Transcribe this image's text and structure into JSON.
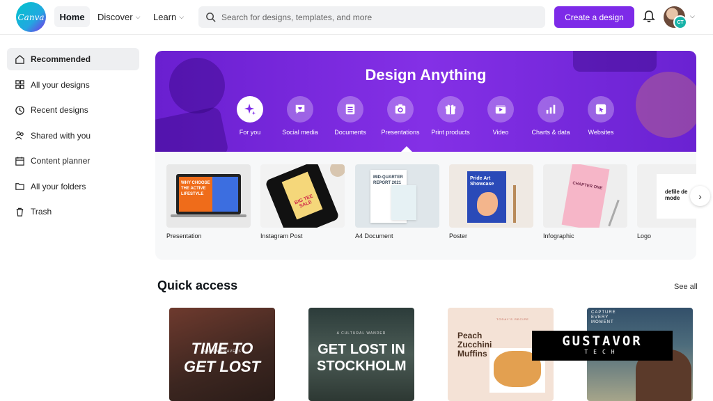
{
  "brand": {
    "logo_text": "Canva",
    "accent": "#7d2ae8"
  },
  "topnav": {
    "home": "Home",
    "discover": "Discover",
    "learn": "Learn",
    "search_placeholder": "Search for designs, templates, and more",
    "create_button": "Create a design",
    "avatar_initials": "CT"
  },
  "sidebar": {
    "items": [
      {
        "label": "Recommended",
        "icon": "home-icon"
      },
      {
        "label": "All your designs",
        "icon": "grid-icon"
      },
      {
        "label": "Recent designs",
        "icon": "clock-icon"
      },
      {
        "label": "Shared with you",
        "icon": "people-icon"
      },
      {
        "label": "Content planner",
        "icon": "calendar-icon"
      },
      {
        "label": "All your folders",
        "icon": "folder-icon"
      },
      {
        "label": "Trash",
        "icon": "trash-icon"
      }
    ]
  },
  "hero": {
    "title": "Design Anything",
    "categories": [
      {
        "label": "For you",
        "icon": "sparkle-icon"
      },
      {
        "label": "Social media",
        "icon": "heart-chat-icon"
      },
      {
        "label": "Documents",
        "icon": "document-icon"
      },
      {
        "label": "Presentations",
        "icon": "presentation-icon"
      },
      {
        "label": "Print products",
        "icon": "gift-icon"
      },
      {
        "label": "Video",
        "icon": "video-icon"
      },
      {
        "label": "Charts & data",
        "icon": "bar-chart-icon"
      },
      {
        "label": "Websites",
        "icon": "cursor-icon"
      }
    ]
  },
  "templates": [
    {
      "label": "Presentation",
      "thumb_text": "WHY CHOOSE THE ACTIVE LIFESTYLE"
    },
    {
      "label": "Instagram Post",
      "thumb_text": "BIG TEE SALE"
    },
    {
      "label": "A4 Document",
      "thumb_text": "MID-QUARTER REPORT 2021"
    },
    {
      "label": "Poster",
      "thumb_text": "Pride Art Showcase"
    },
    {
      "label": "Infographic",
      "thumb_text": "CHAPTER ONE"
    },
    {
      "label": "Logo",
      "thumb_text": "defile de mode"
    }
  ],
  "quick_access": {
    "title": "Quick access",
    "see_all": "See all",
    "cards": [
      {
        "small": "SILTON TRAVELS",
        "big": "TIME TO GET LOST"
      },
      {
        "small": "A CULTURAL WANDER",
        "big": "GET LOST IN STOCKHOLM"
      },
      {
        "small": "TODAY'S RECIPE",
        "big": "Peach Zucchini Muffins"
      },
      {
        "small": "CAPTURE EVERY MOMENT",
        "big": ""
      }
    ]
  },
  "watermark": {
    "main": "GUSTAVOR",
    "sub": "TECH"
  }
}
